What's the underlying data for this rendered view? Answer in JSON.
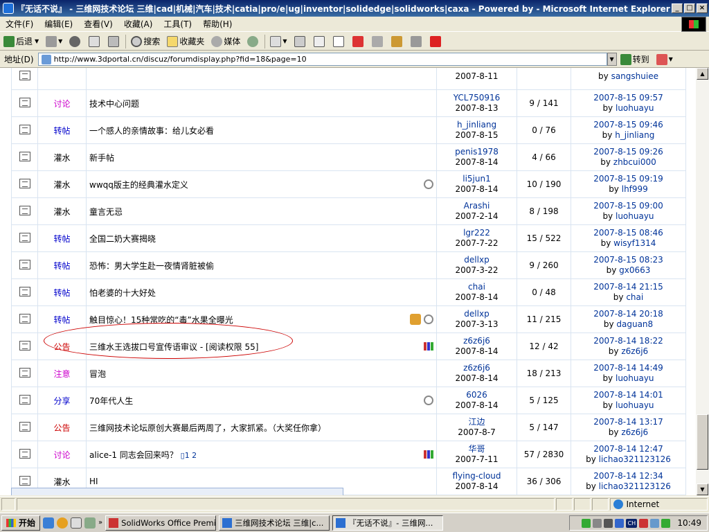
{
  "window": {
    "title": "『无话不说』 - 三维网技术论坛 三维|cad|机械|汽车|技术|catia|pro/e|ug|inventor|solidedge|solidworks|caxa - Powered by - Microsoft Internet Explorer"
  },
  "menu": [
    "文件(F)",
    "编辑(E)",
    "查看(V)",
    "收藏(A)",
    "工具(T)",
    "帮助(H)"
  ],
  "toolbar": {
    "back": "后退",
    "search": "搜索",
    "favorites": "收藏夹",
    "media": "媒体"
  },
  "address": {
    "label": "地址(D)",
    "url": "http://www.3dportal.cn/discuz/forumdisplay.php?fid=18&page=10",
    "go": "转到"
  },
  "colors": {
    "link": "#003399",
    "type_red": "#cc0000",
    "type_blue": "#0000cc",
    "type_magenta": "#cc00cc",
    "oval": "#cc0000"
  },
  "threads": [
    {
      "type": "",
      "subject": "",
      "author": "",
      "date": "2007-8-11",
      "replies": "",
      "last_time": "",
      "last_by": "sangshuiee",
      "flags": []
    },
    {
      "type": "讨论",
      "type_color": "#cc00cc",
      "subject": "技术中心问题",
      "author": "YCL750916",
      "date": "2007-8-13",
      "replies": "9 / 141",
      "last_time": "2007-8-15 09:57",
      "last_by": "luohuayu",
      "flags": []
    },
    {
      "type": "转帖",
      "type_color": "#0000cc",
      "subject": "一个感人的亲情故事：给儿女必看",
      "author": "h_jinliang",
      "date": "2007-8-15",
      "replies": "0 / 76",
      "last_time": "2007-8-15 09:46",
      "last_by": "h_jinliang",
      "flags": []
    },
    {
      "type": "灌水",
      "type_color": "#000000",
      "subject": "新手帖",
      "author": "penis1978",
      "date": "2007-8-14",
      "replies": "4 / 66",
      "last_time": "2007-8-15 09:26",
      "last_by": "zhbcui000",
      "flags": []
    },
    {
      "type": "灌水",
      "type_color": "#000000",
      "subject": "wwqq版主的经典灌水定义",
      "author": "li5jun1",
      "date": "2007-8-14",
      "replies": "10 / 190",
      "last_time": "2007-8-15 09:19",
      "last_by": "lhf999",
      "flags": [
        "attach"
      ]
    },
    {
      "type": "灌水",
      "type_color": "#000000",
      "subject": "童言无忌",
      "author": "Arashi",
      "date": "2007-2-14",
      "replies": "8 / 198",
      "last_time": "2007-8-15 09:00",
      "last_by": "luohuayu",
      "flags": []
    },
    {
      "type": "转帖",
      "type_color": "#0000cc",
      "subject": "全国二奶大赛揭晓",
      "author": "lgr222",
      "date": "2007-7-22",
      "replies": "15 / 522",
      "last_time": "2007-8-15 08:46",
      "last_by": "wisyf1314",
      "flags": []
    },
    {
      "type": "转帖",
      "type_color": "#0000cc",
      "subject": "恐怖：男大学生赴一夜情肾脏被偷",
      "author": "dellxp",
      "date": "2007-3-22",
      "replies": "9 / 260",
      "last_time": "2007-8-15 08:23",
      "last_by": "gx0663",
      "flags": []
    },
    {
      "type": "转帖",
      "type_color": "#0000cc",
      "subject": "怕老婆的十大好处",
      "author": "chai",
      "date": "2007-8-14",
      "replies": "0 / 48",
      "last_time": "2007-8-14 21:15",
      "last_by": "chai",
      "flags": []
    },
    {
      "type": "转帖",
      "type_color": "#0000cc",
      "subject": "触目惊心！15种常吃的“毒”水果全曝光",
      "author": "dellxp",
      "date": "2007-3-13",
      "replies": "11 / 215",
      "last_time": "2007-8-14 20:18",
      "last_by": "daguan8",
      "flags": [
        "thumb",
        "attach"
      ]
    },
    {
      "type": "公告",
      "type_color": "#cc0000",
      "subject": "三维水王选拔口号宣传语审议 - [阅读权限 55]",
      "author": "z6z6j6",
      "date": "2007-8-14",
      "replies": "12 / 42",
      "last_time": "2007-8-14 18:22",
      "last_by": "z6z6j6",
      "flags": [
        "poll"
      ]
    },
    {
      "type": "注意",
      "type_color": "#cc00cc",
      "subject": "冒泡",
      "author": "z6z6j6",
      "date": "2007-8-14",
      "replies": "18 / 213",
      "last_time": "2007-8-14 14:49",
      "last_by": "luohuayu",
      "flags": []
    },
    {
      "type": "分享",
      "type_color": "#0000cc",
      "subject": "70年代人生",
      "author": "6026",
      "date": "2007-8-14",
      "replies": "5 / 125",
      "last_time": "2007-8-14 14:01",
      "last_by": "luohuayu",
      "flags": [
        "attach"
      ]
    },
    {
      "type": "公告",
      "type_color": "#cc0000",
      "subject": "三维网技术论坛原创大赛最后两周了，大家抓紧。（大奖任你拿）",
      "author": "江边",
      "date": "2007-8-7",
      "replies": "5 / 147",
      "last_time": "2007-8-14 13:17",
      "last_by": "z6z6j6",
      "flags": []
    },
    {
      "type": "讨论",
      "type_color": "#cc00cc",
      "subject": "alice-1 同志会回来吗？",
      "pages": "1 2",
      "author": "华哥",
      "date": "2007-7-11",
      "replies": "57 / 2830",
      "last_time": "2007-8-14 12:47",
      "last_by": "lichao321123126",
      "flags": [
        "poll"
      ]
    },
    {
      "type": "灌水",
      "type_color": "#000000",
      "subject": "HI",
      "author": "flying-cloud",
      "date": "2007-8-14",
      "replies": "36 / 306",
      "last_time": "2007-8-14 12:34",
      "last_by": "lichao321123126",
      "flags": []
    }
  ],
  "status": {
    "zone": "Internet"
  },
  "taskbar": {
    "start": "开始",
    "tasks": [
      "SolidWorks Office Premiu...",
      "三维网技术论坛 三维|c...",
      "『无话不说』- 三维网..."
    ],
    "clock": "10:49",
    "ime": "CH"
  }
}
